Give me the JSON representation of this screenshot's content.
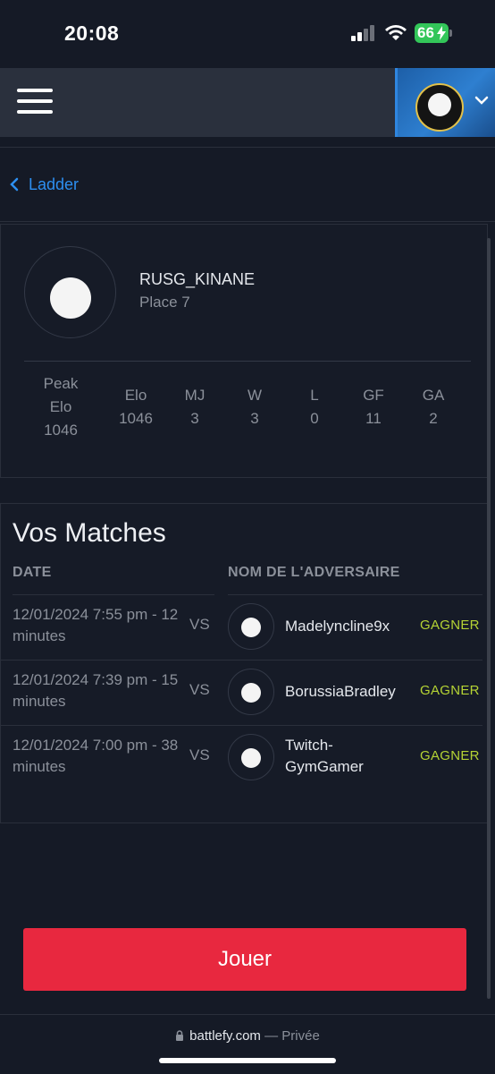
{
  "status_bar": {
    "time": "20:08",
    "battery": "66"
  },
  "nav": {
    "back_label": "Ladder"
  },
  "player": {
    "name": "RUSG_KINANE",
    "place": "Place 7"
  },
  "stats": [
    {
      "label": "Peak Elo",
      "value": "1046"
    },
    {
      "label": "Elo",
      "value": "1046"
    },
    {
      "label": "MJ",
      "value": "3"
    },
    {
      "label": "W",
      "value": "3"
    },
    {
      "label": "L",
      "value": "0"
    },
    {
      "label": "GF",
      "value": "11"
    },
    {
      "label": "GA",
      "value": "2"
    }
  ],
  "matches_section": {
    "title": "Vos Matches",
    "col_date": "DATE",
    "col_opponent": "NOM DE L'ADVERSAIRE",
    "rows": [
      {
        "date": "12/01/2024 7:55 pm - 12 minutes",
        "vs": "VS",
        "opponent": "Madelyncline9x",
        "result": "GAGNER"
      },
      {
        "date": "12/01/2024 7:39 pm - 15 minutes",
        "vs": "VS",
        "opponent": "BorussiaBradley",
        "result": "GAGNER"
      },
      {
        "date": "12/01/2024 7:00 pm - 38 minutes",
        "vs": "VS",
        "opponent": "Twitch-GymGamer",
        "result": "GAGNER"
      }
    ]
  },
  "play_button": {
    "label": "Jouer"
  },
  "browser": {
    "domain": "battlefy.com",
    "separator": " — ",
    "mode": "Privée"
  },
  "colors": {
    "accent_red": "#e8283f",
    "link_blue": "#2d8ff0",
    "win_green": "#b5d334",
    "bg": "#151a26"
  },
  "icons": [
    "cellular-signal-icon",
    "wifi-icon",
    "battery-icon",
    "hamburger-menu-icon",
    "chevron-down-icon",
    "chevron-left-icon",
    "lock-icon"
  ]
}
